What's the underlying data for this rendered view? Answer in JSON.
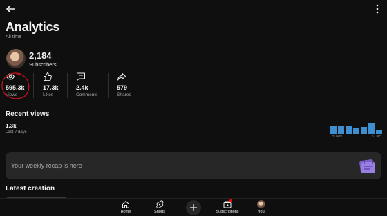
{
  "header": {
    "title": "Analytics",
    "subtitle": "All time",
    "back_icon": "arrow-left-icon",
    "more_icon": "more-vertical-icon"
  },
  "channel": {
    "subscribers_count": "2,184",
    "subscribers_label": "Subscribers"
  },
  "stats": [
    {
      "icon": "eye-icon",
      "value": "595.3k",
      "label": "Views"
    },
    {
      "icon": "thumb-up-icon",
      "value": "17.3k",
      "label": "Likes"
    },
    {
      "icon": "comment-icon",
      "value": "2.4k",
      "label": "Comments"
    },
    {
      "icon": "share-icon",
      "value": "579",
      "label": "Shares"
    }
  ],
  "recent_views": {
    "title": "Recent views",
    "count": "1.3k",
    "period": "Last 7 days",
    "chart_start_label": "29 Nov",
    "chart_end_label": "5 Dec",
    "bar_color": "#3e8ed0",
    "relative_values": [
      0.55,
      0.62,
      0.55,
      0.45,
      0.5,
      0.8,
      0.3
    ]
  },
  "recap": {
    "text": "Your weekly recap is here",
    "icon": "calendar-recap-icon",
    "icon_color": "#7b5fc9"
  },
  "latest": {
    "title": "Latest creation"
  },
  "bottom_nav": {
    "home": "Home",
    "shorts": "Shorts",
    "subscriptions": "Subscriptions",
    "you": "You"
  },
  "annotation_color": "#c4161c"
}
